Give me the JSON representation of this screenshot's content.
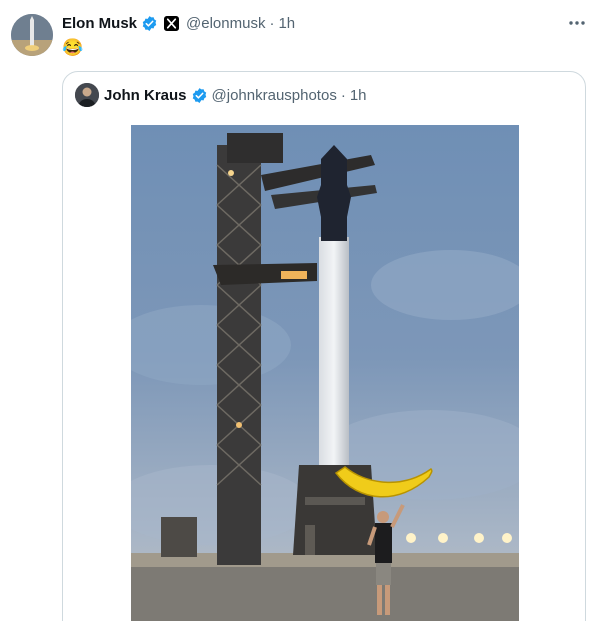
{
  "post": {
    "author": {
      "display_name": "Elon Musk",
      "handle": "@elonmusk",
      "time": "1h"
    },
    "separator": "·",
    "text": "😂",
    "quoted": {
      "author": {
        "display_name": "John Kraus",
        "handle": "@johnkrausphotos",
        "time": "1h"
      },
      "media_type": "photo"
    }
  },
  "icons": {
    "verified": "verified-badge-icon",
    "affiliate": "x-affiliate-icon",
    "more": "more-dots-icon"
  },
  "colors": {
    "verified_blue": "#1d9bf0",
    "text_primary": "#0f1419",
    "text_muted": "#536471",
    "border": "#cfd9de"
  }
}
